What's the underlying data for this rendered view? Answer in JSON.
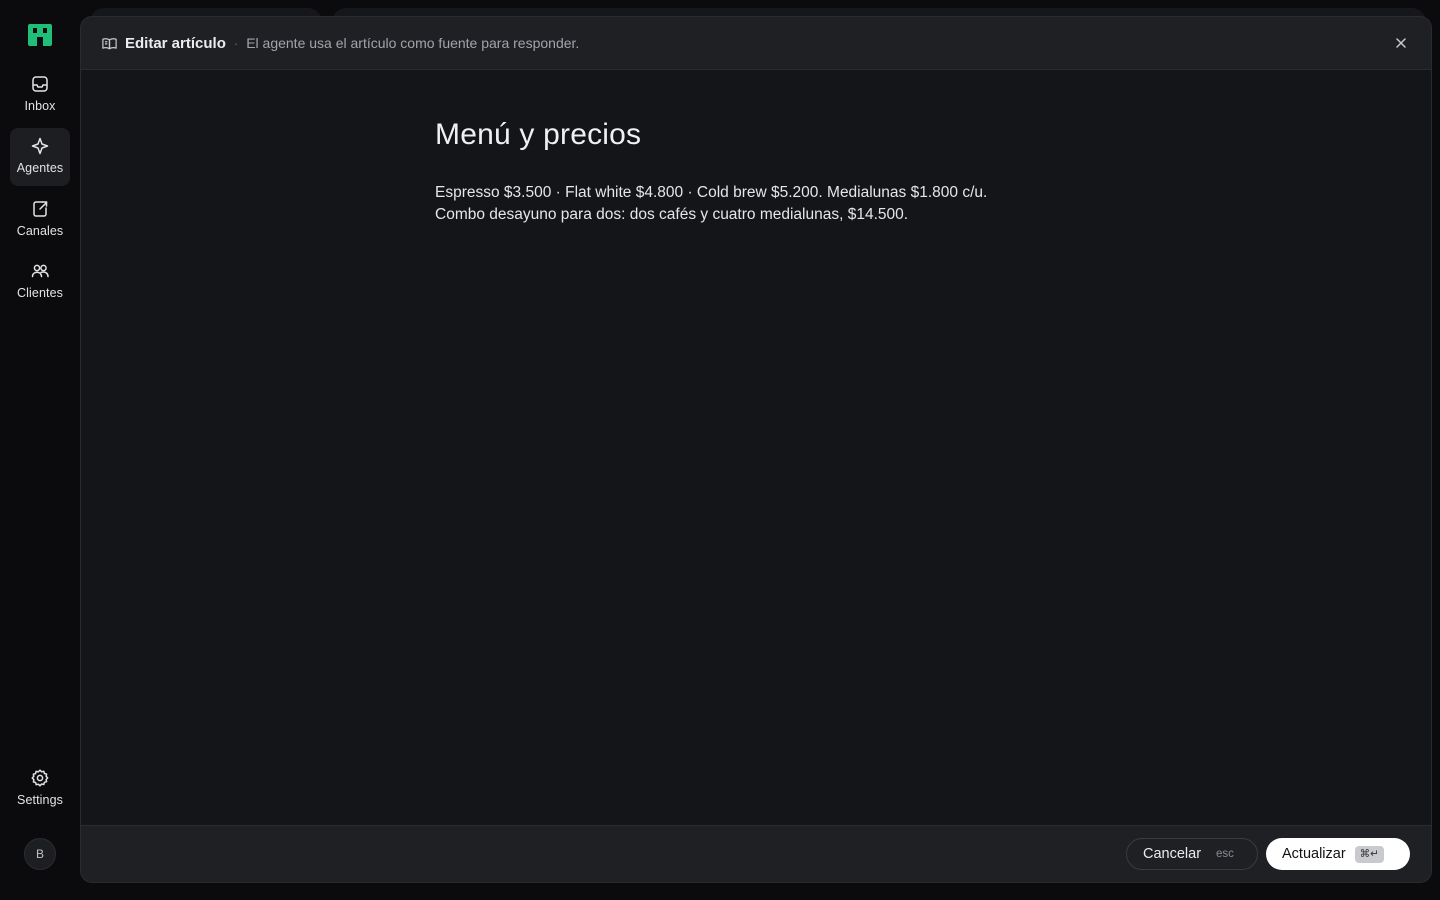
{
  "nav": {
    "items": [
      {
        "label": "Inbox",
        "icon": "inbox-icon"
      },
      {
        "label": "Agentes",
        "icon": "sparkle-icon",
        "active": true
      },
      {
        "label": "Canales",
        "icon": "channel-icon"
      },
      {
        "label": "Clientes",
        "icon": "users-icon"
      }
    ],
    "settings_label": "Settings",
    "avatar_initial": "B",
    "brand_color": "#1fbf7a"
  },
  "modal": {
    "title": "Editar artículo",
    "separator": "·",
    "subtitle": "El agente usa el artículo como fuente para responder.",
    "article": {
      "title": "Menú y precios",
      "lines": [
        "Espresso $3.500 · Flat white $4.800 · Cold brew $5.200. Medialunas $1.800 c/u.",
        "Combo desayuno para dos: dos cafés y cuatro medialunas, $14.500."
      ]
    },
    "footer": {
      "cancel_label": "Cancelar",
      "cancel_shortcut": "esc",
      "update_label": "Actualizar",
      "update_shortcut": "⌘↵"
    }
  }
}
